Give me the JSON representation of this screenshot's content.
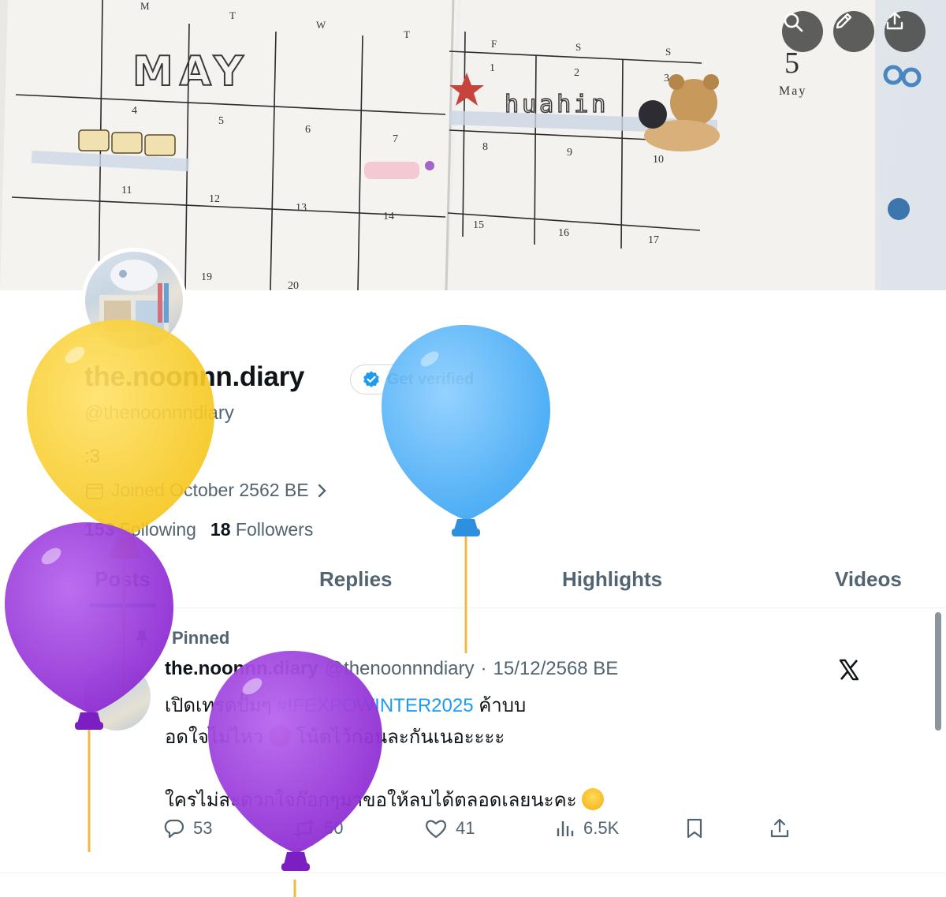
{
  "banner": {
    "weekday_letters": [
      "M",
      "T",
      "W",
      "T",
      "F",
      "S",
      "S"
    ],
    "month_word": "MAY",
    "place_word": "huahin",
    "date_numbers": [
      "4",
      "5",
      "6",
      "7",
      "11",
      "12",
      "13",
      "14",
      "19",
      "20",
      "1",
      "2",
      "3",
      "8",
      "9",
      "10",
      "15",
      "16",
      "17"
    ],
    "corner_day": "5",
    "corner_month": "May",
    "icons": [
      "search-icon",
      "edit-pencil-icon",
      "share-upload-icon"
    ]
  },
  "profile": {
    "display_name": "the.noonnn.diary",
    "get_verified_label": "Get verified",
    "handle": "@thenoonnndiary",
    "bio": ":3",
    "joined": "Joined October 2562 BE",
    "following_count": "153",
    "following_label": "Following",
    "followers_count": "18",
    "followers_label": "Followers"
  },
  "tabs": [
    {
      "label": "Posts",
      "active": true
    },
    {
      "label": "Replies",
      "active": false
    },
    {
      "label": "Highlights",
      "active": false
    },
    {
      "label": "Videos",
      "active": false
    }
  ],
  "tweet": {
    "pinned_label": "Pinned",
    "author_name": "the.noonnn.diary",
    "author_handle": "@thenoonnndiary",
    "separator": "·",
    "date": "15/12/2568 BE",
    "line1_pre": "เปิดเทรดปั๊มๆ ",
    "hashtag": "#IFEXPOWINTER2025",
    "line1_post": " ค้าบบ",
    "line2_pre": "อดใจไม่ไหว ",
    "line2_post": " โน้ตไว้ก่อนละกันเนอะะะะ",
    "line3": "ใครไม่สะดวกใจก๊อกๆมาขอให้ลบได้ตลอดเลยนะคะ ",
    "replies": "53",
    "reposts": "50",
    "likes": "41",
    "views": "6.5K"
  },
  "colors": {
    "accent_blue": "#1d9bf0",
    "balloon_yellow": "#f7cd2f",
    "balloon_blue": "#5bb5f5",
    "balloon_purple": "#9b3ddc"
  }
}
